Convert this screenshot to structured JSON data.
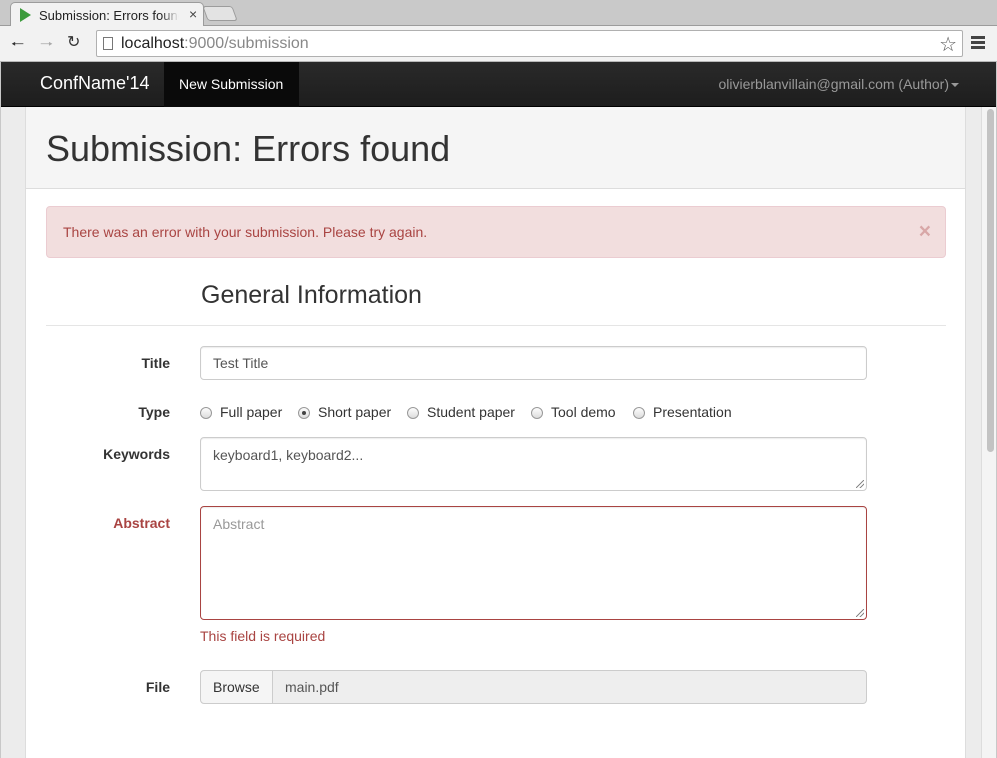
{
  "browser": {
    "tab_title": "Submission: Errors found",
    "tab_close": "×",
    "url_host": "localhost",
    "url_rest": ":9000/submission"
  },
  "navbar": {
    "brand": "ConfName'14",
    "active_item": "New Submission",
    "user": "olivierblanvillain@gmail.com (Author)"
  },
  "header": {
    "title": "Submission: Errors found"
  },
  "alert": {
    "message": "There was an error with your submission. Please try again.",
    "close": "×"
  },
  "form": {
    "section_title": "General Information",
    "title_label": "Title",
    "title_value": "Test Title",
    "type_label": "Type",
    "type_options": [
      "Full paper",
      "Short paper",
      "Student paper",
      "Tool demo",
      "Presentation"
    ],
    "type_selected": "Short paper",
    "keywords_label": "Keywords",
    "keywords_value": "keyboard1, keyboard2...",
    "abstract_label": "Abstract",
    "abstract_placeholder": "Abstract",
    "abstract_error": "This field is required",
    "file_label": "File",
    "browse_label": "Browse",
    "file_name": "main.pdf"
  },
  "colors": {
    "error": "#a94442",
    "alert_bg": "#f2dede",
    "navbar": "#222222"
  }
}
